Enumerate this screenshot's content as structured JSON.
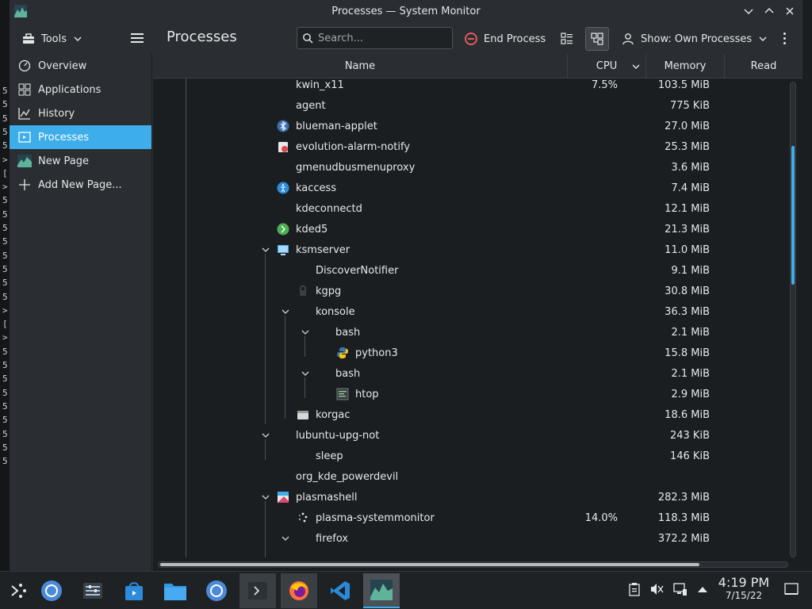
{
  "window": {
    "title": "Processes — System Monitor"
  },
  "toolbar": {
    "tools_label": "Tools",
    "page_title": "Processes",
    "search_placeholder": "Search...",
    "end_process_label": "End Process",
    "show_label": "Show: Own Processes"
  },
  "sidebar": {
    "items": [
      {
        "label": "Overview",
        "icon": "speedometer-icon"
      },
      {
        "label": "Applications",
        "icon": "grid-icon"
      },
      {
        "label": "History",
        "icon": "chart-icon"
      },
      {
        "label": "Processes",
        "icon": "processes-icon",
        "active": true
      },
      {
        "label": "New Page",
        "icon": "page-icon"
      },
      {
        "label": "Add New Page...",
        "icon": "plus-icon"
      }
    ]
  },
  "table": {
    "columns": {
      "name": "Name",
      "cpu": "CPU",
      "memory": "Memory",
      "read": "Read"
    },
    "rows": [
      {
        "name": "kwin_x11",
        "cpu": "7.5%",
        "memory": "103.5 MiB"
      },
      {
        "name": "agent",
        "cpu": "",
        "memory": "775 KiB"
      },
      {
        "name": "blueman-applet",
        "cpu": "",
        "memory": "27.0 MiB"
      },
      {
        "name": "evolution-alarm-notify",
        "cpu": "",
        "memory": "25.3 MiB"
      },
      {
        "name": "gmenudbusmenuproxy",
        "cpu": "",
        "memory": "3.6 MiB"
      },
      {
        "name": "kaccess",
        "cpu": "",
        "memory": "7.4 MiB"
      },
      {
        "name": "kdeconnectd",
        "cpu": "",
        "memory": "12.1 MiB"
      },
      {
        "name": "kded5",
        "cpu": "",
        "memory": "21.3 MiB"
      },
      {
        "name": "ksmserver",
        "cpu": "",
        "memory": "11.0 MiB"
      },
      {
        "name": "DiscoverNotifier",
        "cpu": "",
        "memory": "9.1 MiB"
      },
      {
        "name": "kgpg",
        "cpu": "",
        "memory": "30.8 MiB"
      },
      {
        "name": "konsole",
        "cpu": "",
        "memory": "36.3 MiB"
      },
      {
        "name": "bash",
        "cpu": "",
        "memory": "2.1 MiB"
      },
      {
        "name": "python3",
        "cpu": "",
        "memory": "15.8 MiB"
      },
      {
        "name": "bash",
        "cpu": "",
        "memory": "2.1 MiB"
      },
      {
        "name": "htop",
        "cpu": "",
        "memory": "2.9 MiB"
      },
      {
        "name": "korgac",
        "cpu": "",
        "memory": "18.6 MiB"
      },
      {
        "name": "lubuntu-upg-not",
        "cpu": "",
        "memory": "243 KiB"
      },
      {
        "name": "sleep",
        "cpu": "",
        "memory": "146 KiB"
      },
      {
        "name": "org_kde_powerdevil",
        "cpu": "",
        "memory": ""
      },
      {
        "name": "plasmashell",
        "cpu": "",
        "memory": "282.3 MiB"
      },
      {
        "name": "plasma-systemmonitor",
        "cpu": "14.0%",
        "memory": "118.3 MiB"
      },
      {
        "name": "firefox",
        "cpu": "",
        "memory": "372.2 MiB"
      }
    ]
  },
  "taskbar": {
    "time": "4:19 PM",
    "date": "7/15/22"
  },
  "background_terminal": {
    "lines": [
      "5",
      "5",
      "5",
      "5",
      "5",
      ">",
      "[",
      ">",
      "5",
      "5",
      "5",
      "5",
      "5",
      "5",
      "5",
      "5",
      ">",
      "[",
      ">",
      "5",
      "5",
      "5",
      "5",
      "5",
      "5",
      "5",
      "5",
      "5"
    ]
  },
  "colors": {
    "accent": "#3daee9",
    "window_bg": "#2a2e32",
    "table_bg": "#1b1e20",
    "end_process": "#e05a5a"
  }
}
